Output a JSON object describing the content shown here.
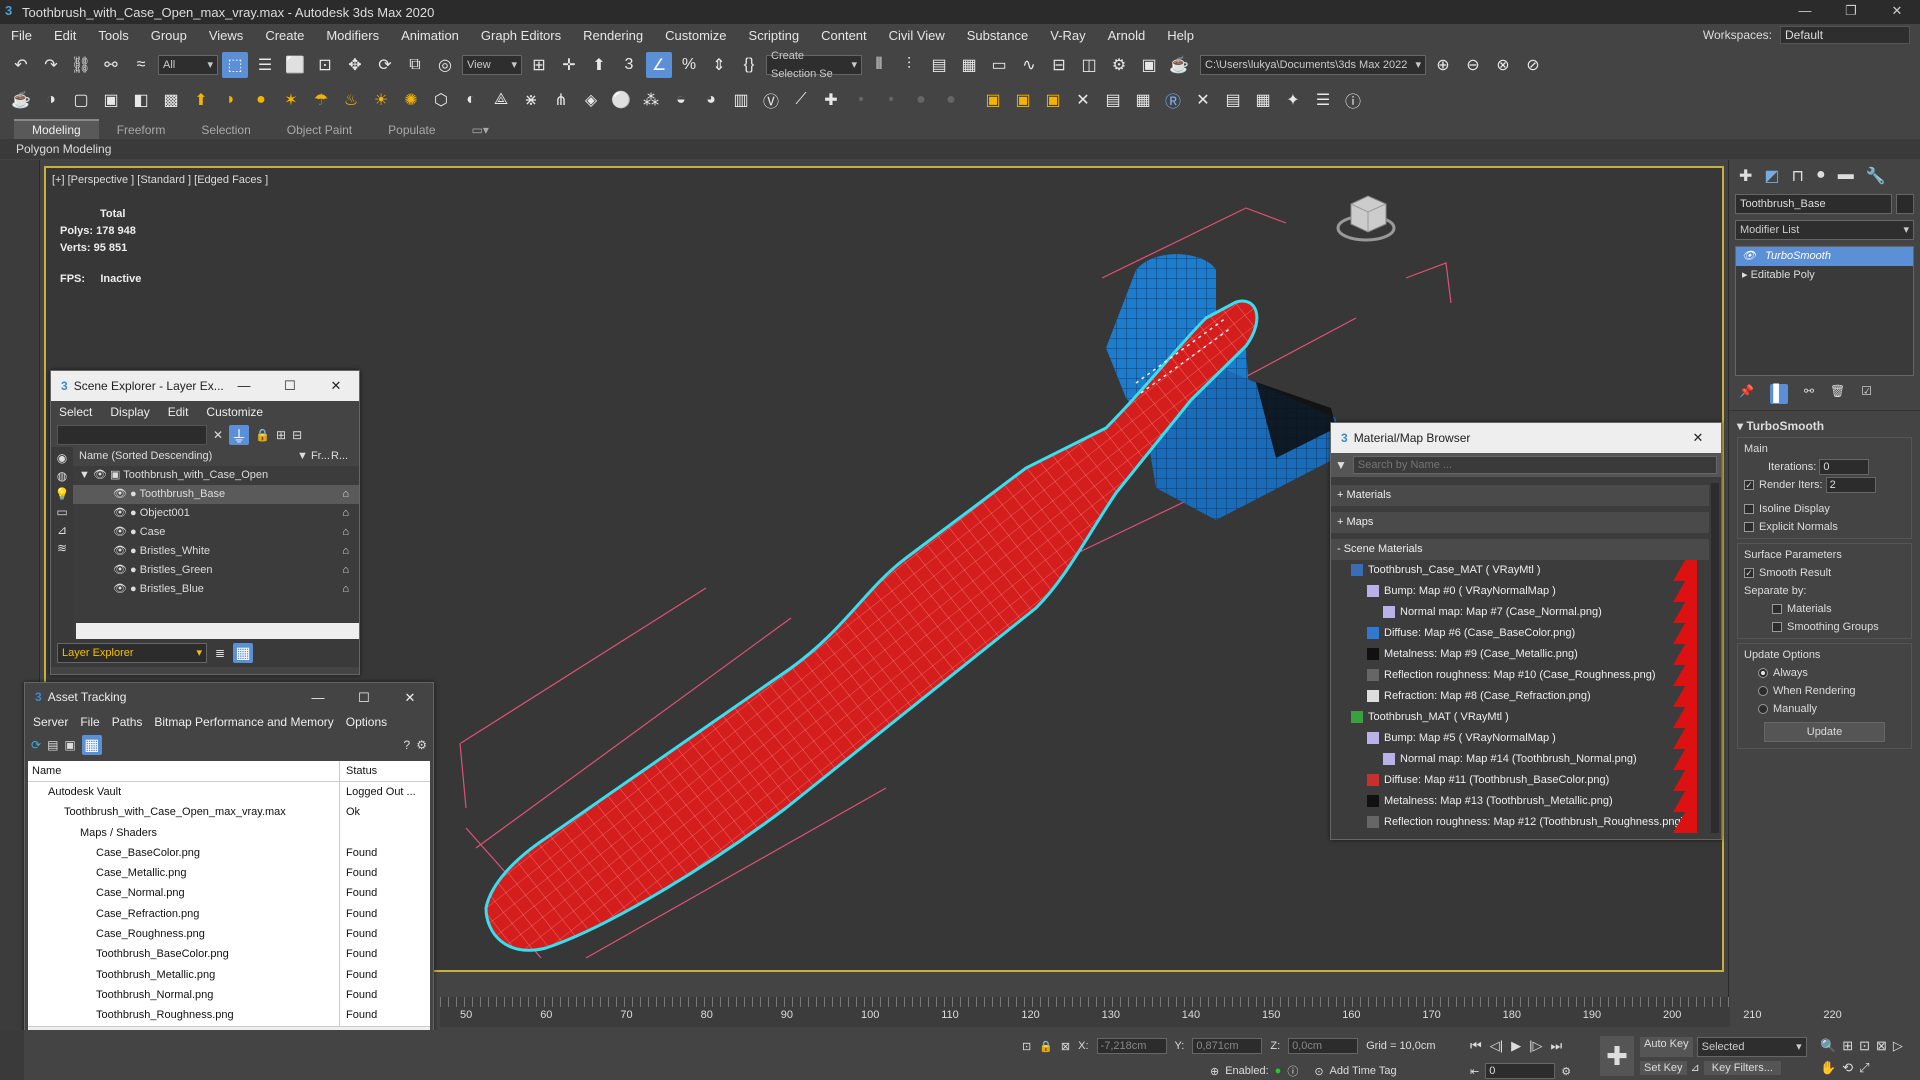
{
  "title": "Toothbrush_with_Case_Open_max_vray.max - Autodesk 3ds Max 2020",
  "window_controls": [
    "—",
    "❐",
    "✕"
  ],
  "menu": [
    "File",
    "Edit",
    "Tools",
    "Group",
    "Views",
    "Create",
    "Modifiers",
    "Animation",
    "Graph Editors",
    "Rendering",
    "Customize",
    "Scripting",
    "Content",
    "Civil View",
    "Substance",
    "V-Ray",
    "Arnold",
    "Help"
  ],
  "workspace": {
    "label": "Workspaces:",
    "value": "Default"
  },
  "toolbar": {
    "filter": "All",
    "view": "View",
    "selection_set": "Create Selection Se",
    "path": "C:\\Users\\lukya\\Documents\\3ds Max 2022"
  },
  "ribbon": {
    "tabs": [
      "Modeling",
      "Freeform",
      "Selection",
      "Object Paint",
      "Populate"
    ],
    "active": "Modeling",
    "sub": "Polygon Modeling"
  },
  "viewport": {
    "label": "[+] [Perspective ] [Standard ] [Edged Faces ]",
    "stats": {
      "total": "Total",
      "polys_label": "Polys:",
      "polys": "178 948",
      "verts_label": "Verts:",
      "verts": "95 851",
      "fps_label": "FPS:",
      "fps": "Inactive"
    }
  },
  "scene_explorer": {
    "title": "Scene Explorer - Layer Ex...",
    "menu": [
      "Select",
      "Display",
      "Edit",
      "Customize"
    ],
    "col_name": "Name (Sorted Descending)",
    "col_fr": "▼ Fr...",
    "col_r": "R...",
    "root": "Toothbrush_with_Case_Open",
    "items": [
      "Toothbrush_Base",
      "Object001",
      "Case",
      "Bristles_White",
      "Bristles_Green",
      "Bristles_Blue"
    ],
    "selected": "Toothbrush_Base",
    "footer": "Layer Explorer"
  },
  "asset_tracking": {
    "title": "Asset Tracking",
    "menu": [
      "Server",
      "File",
      "Paths",
      "Bitmap Performance and Memory",
      "Options"
    ],
    "col_name": "Name",
    "col_status": "Status",
    "rows": [
      {
        "name": "Autodesk Vault",
        "status": "Logged Out ...",
        "indent": 0
      },
      {
        "name": "Toothbrush_with_Case_Open_max_vray.max",
        "status": "Ok",
        "indent": 1
      },
      {
        "name": "Maps / Shaders",
        "status": "",
        "indent": 2
      },
      {
        "name": "Case_BaseColor.png",
        "status": "Found",
        "indent": 3
      },
      {
        "name": "Case_Metallic.png",
        "status": "Found",
        "indent": 3
      },
      {
        "name": "Case_Normal.png",
        "status": "Found",
        "indent": 3
      },
      {
        "name": "Case_Refraction.png",
        "status": "Found",
        "indent": 3
      },
      {
        "name": "Case_Roughness.png",
        "status": "Found",
        "indent": 3
      },
      {
        "name": "Toothbrush_BaseColor.png",
        "status": "Found",
        "indent": 3
      },
      {
        "name": "Toothbrush_Metallic.png",
        "status": "Found",
        "indent": 3
      },
      {
        "name": "Toothbrush_Normal.png",
        "status": "Found",
        "indent": 3
      },
      {
        "name": "Toothbrush_Roughness.png",
        "status": "Found",
        "indent": 3
      }
    ]
  },
  "material_browser": {
    "title": "Material/Map Browser",
    "search": "Search by Name ...",
    "groups": [
      "+ Materials",
      "+ Maps",
      "- Scene Materials"
    ],
    "rows": [
      {
        "text": "Toothbrush_Case_MAT  ( VRayMtl )",
        "level": 0,
        "swatch": "#3a6db5"
      },
      {
        "text": "Bump: Map #0  ( VRayNormalMap )",
        "level": 1,
        "swatch": "#b9b2e8"
      },
      {
        "text": "Normal map: Map #7 (Case_Normal.png)",
        "level": 2,
        "swatch": "#b9b2e8"
      },
      {
        "text": "Diffuse: Map #6 (Case_BaseColor.png)",
        "level": 1,
        "swatch": "#2f7ad0"
      },
      {
        "text": "Metalness: Map #9 (Case_Metallic.png)",
        "level": 1,
        "swatch": "#111111"
      },
      {
        "text": "Reflection roughness: Map #10 (Case_Roughness.png)",
        "level": 1,
        "swatch": "#666666"
      },
      {
        "text": "Refraction: Map #8 (Case_Refraction.png)",
        "level": 1,
        "swatch": "#dddddd"
      },
      {
        "text": "Toothbrush_MAT  ( VRayMtl )",
        "level": 0,
        "swatch": "#3aa040"
      },
      {
        "text": "Bump: Map #5  ( VRayNormalMap )",
        "level": 1,
        "swatch": "#b9b2e8"
      },
      {
        "text": "Normal map: Map #14 (Toothbrush_Normal.png)",
        "level": 2,
        "swatch": "#b9b2e8"
      },
      {
        "text": "Diffuse: Map #11 (Toothbrush_BaseColor.png)",
        "level": 1,
        "swatch": "#c83030"
      },
      {
        "text": "Metalness: Map #13 (Toothbrush_Metallic.png)",
        "level": 1,
        "swatch": "#111111"
      },
      {
        "text": "Reflection roughness: Map #12 (Toothbrush_Roughness.png)",
        "level": 1,
        "swatch": "#666666"
      }
    ]
  },
  "command_panel": {
    "object_name": "Toothbrush_Base",
    "modifier_list": "Modifier List",
    "stack": [
      "TurboSmooth",
      "Editable Poly"
    ],
    "rollout": "TurboSmooth",
    "main": "Main",
    "iterations_label": "Iterations:",
    "iterations": "0",
    "render_iters_label": "Render Iters:",
    "render_iters": "2",
    "isoline": "Isoline Display",
    "explicit": "Explicit Normals",
    "surface_params": "Surface Parameters",
    "smooth_result": "Smooth Result",
    "separate_by": "Separate by:",
    "materials": "Materials",
    "smoothing_groups": "Smoothing Groups",
    "update_options": "Update Options",
    "always": "Always",
    "when_rendering": "When Rendering",
    "manually": "Manually",
    "update_btn": "Update"
  },
  "timeline": {
    "ticks": [
      "50",
      "60",
      "70",
      "80",
      "90",
      "100",
      "110",
      "120",
      "130",
      "140",
      "150",
      "160",
      "170",
      "180",
      "190",
      "200",
      "210",
      "220"
    ]
  },
  "statusbar": {
    "x_label": "X:",
    "x": "-7,218cm",
    "y_label": "Y:",
    "y": "0,871cm",
    "z_label": "Z:",
    "z": "0,0cm",
    "grid": "Grid = 10,0cm",
    "enabled": "Enabled:",
    "add_time_tag": "Add Time Tag",
    "auto_key": "Auto Key",
    "selected": "Selected",
    "set_key": "Set Key",
    "key_filters": "Key Filters...",
    "frame": "0"
  }
}
